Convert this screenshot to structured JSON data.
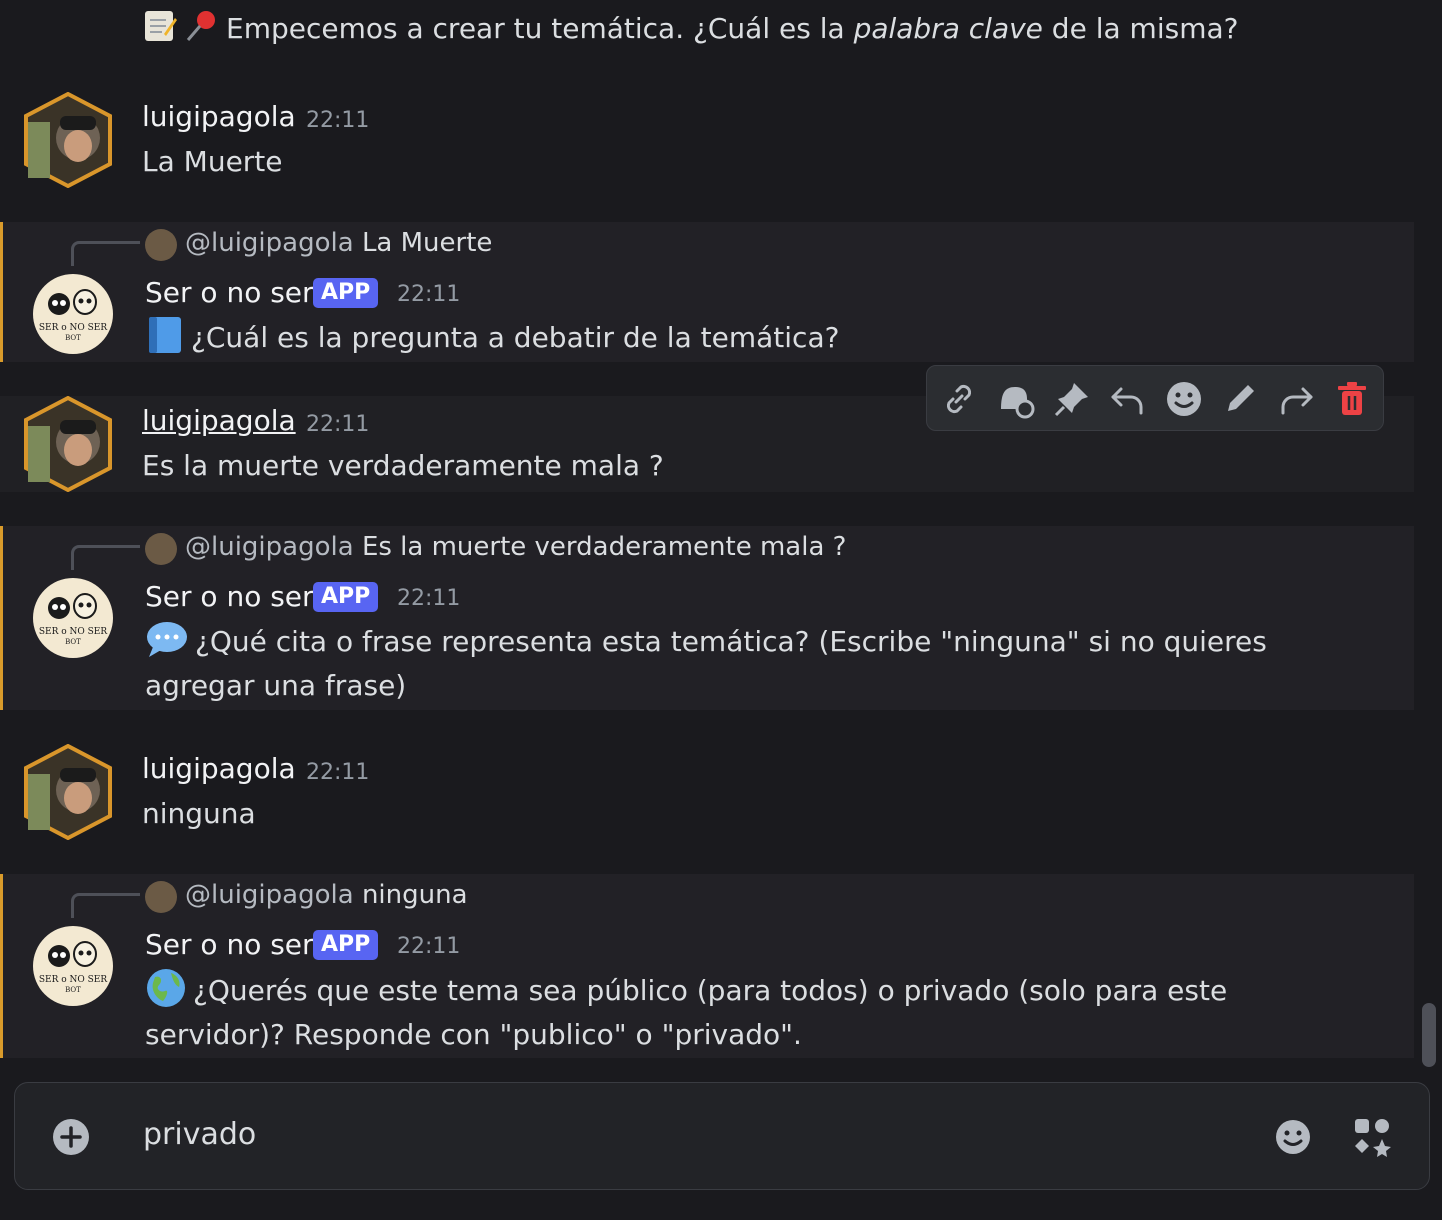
{
  "top_message": {
    "text_before": "Empecemos a crear tu temática. ¿Cuál es la ",
    "text_italic": "palabra clave",
    "text_after": " de la misma?"
  },
  "messages": [
    {
      "author": "luigipagola",
      "time": "22:11",
      "text": "La Muerte"
    },
    {
      "reply_mention": "@luigipagola",
      "reply_text": "La Muerte",
      "author": "Ser o no ser",
      "badge": "APP",
      "time": "22:11",
      "text": "¿Cuál es la pregunta a debatir de la temática?"
    },
    {
      "author": "luigipagola",
      "time": "22:11",
      "text": "Es la muerte verdaderamente mala ?"
    },
    {
      "reply_mention": "@luigipagola",
      "reply_text": "Es la muerte verdaderamente mala ?",
      "author": "Ser o no ser",
      "badge": "APP",
      "time": "22:11",
      "text": "¿Qué cita o frase representa esta temática? (Escribe \"ninguna\" si no quieres agregar una frase)"
    },
    {
      "author": "luigipagola",
      "time": "22:11",
      "text": "ninguna"
    },
    {
      "reply_mention": "@luigipagola",
      "reply_text": "ninguna",
      "author": "Ser o no ser",
      "badge": "APP",
      "time": "22:11",
      "text": "¿Querés que este tema sea público (para todos) o privado (solo para este servidor)? Responde con \"publico\" o \"privado\"."
    }
  ],
  "bot_avatar_text": {
    "line1": "SER o NO SER",
    "line2": "BOT"
  },
  "toolbar_icons": [
    "link-icon",
    "thread-icon",
    "pin-icon",
    "reply-icon",
    "emoji-icon",
    "edit-icon",
    "forward-icon",
    "delete-icon"
  ],
  "composer": {
    "value": "privado"
  },
  "colors": {
    "accent": "#5865f2",
    "bot_border": "#d99b2b",
    "delete": "#ed4245"
  }
}
